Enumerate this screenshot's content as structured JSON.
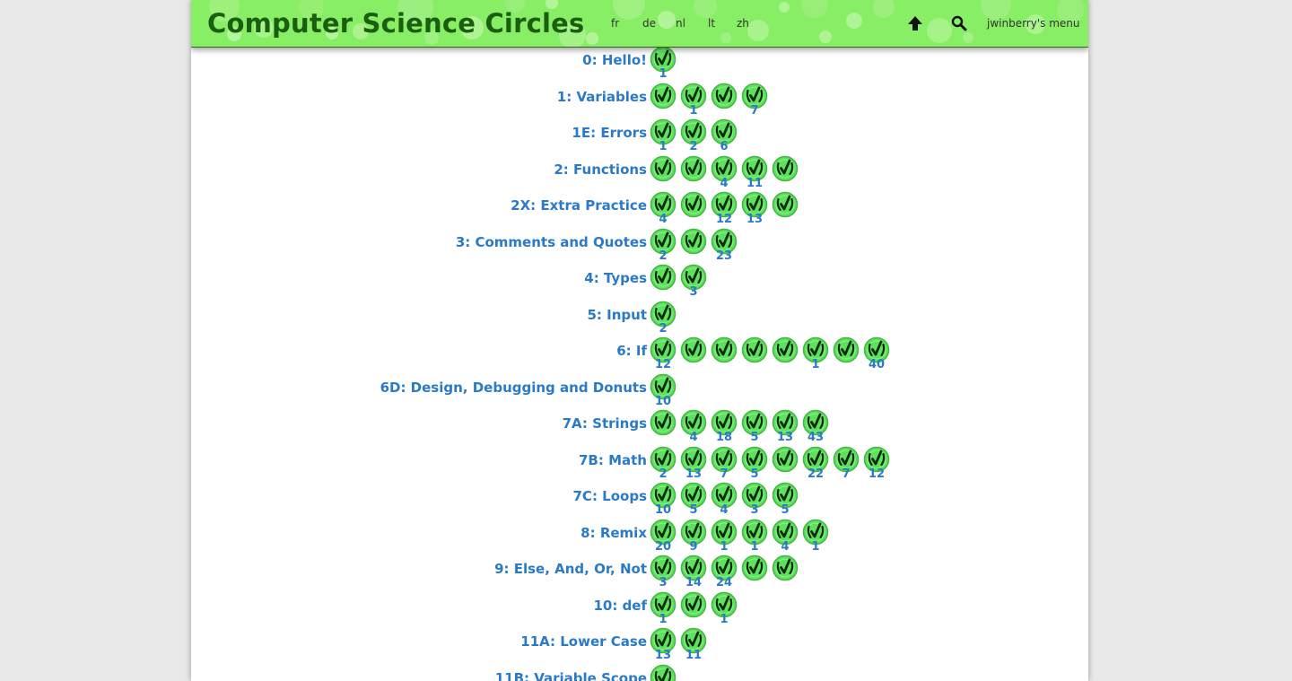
{
  "header": {
    "site_title": "Computer Science Circles",
    "languages": [
      "fr",
      "de",
      "nl",
      "lt",
      "zh"
    ],
    "user_menu": "jwinberry's menu",
    "up_icon": "up-arrow-icon",
    "search_icon": "search-icon"
  },
  "colors": {
    "header_bg": "#88ee66",
    "title": "#1a5e10",
    "link": "#2a7ac8",
    "badge_fill": "#5fe05f",
    "badge_check": "#0a2a0a"
  },
  "badge_icon": "check-badge-icon",
  "lessons": [
    {
      "title": "0: Hello!",
      "badges": [
        "1"
      ]
    },
    {
      "title": "1: Variables",
      "badges": [
        "",
        "1",
        "",
        "7"
      ]
    },
    {
      "title": "1E: Errors",
      "badges": [
        "1",
        "2",
        "6"
      ]
    },
    {
      "title": "2: Functions",
      "badges": [
        "",
        "",
        "4",
        "11",
        ""
      ]
    },
    {
      "title": "2X: Extra Practice",
      "badges": [
        "4",
        "",
        "12",
        "13",
        ""
      ]
    },
    {
      "title": "3: Comments and Quotes",
      "badges": [
        "2",
        "",
        "23"
      ]
    },
    {
      "title": "4: Types",
      "badges": [
        "",
        "3"
      ]
    },
    {
      "title": "5: Input",
      "badges": [
        "2"
      ]
    },
    {
      "title": "6: If",
      "badges": [
        "12",
        "",
        "",
        "",
        "",
        "1",
        "",
        "40"
      ]
    },
    {
      "title": "6D: Design, Debugging and Donuts",
      "badges": [
        "10"
      ]
    },
    {
      "title": "7A: Strings",
      "badges": [
        "",
        "4",
        "18",
        "5",
        "13",
        "43"
      ]
    },
    {
      "title": "7B: Math",
      "badges": [
        "2",
        "13",
        "7",
        "5",
        "",
        "22",
        "7",
        "12"
      ]
    },
    {
      "title": "7C: Loops",
      "badges": [
        "10",
        "5",
        "4",
        "3",
        "5"
      ]
    },
    {
      "title": "8: Remix",
      "badges": [
        "20",
        "9",
        "1",
        "1",
        "4",
        "1"
      ]
    },
    {
      "title": "9: Else, And, Or, Not",
      "badges": [
        "3",
        "14",
        "24",
        "",
        ""
      ]
    },
    {
      "title": "10: def",
      "badges": [
        "1",
        "",
        "1"
      ]
    },
    {
      "title": "11A: Lower Case",
      "badges": [
        "13",
        "11"
      ]
    },
    {
      "title": "11B: Variable Scope",
      "badges": [
        ""
      ]
    }
  ]
}
